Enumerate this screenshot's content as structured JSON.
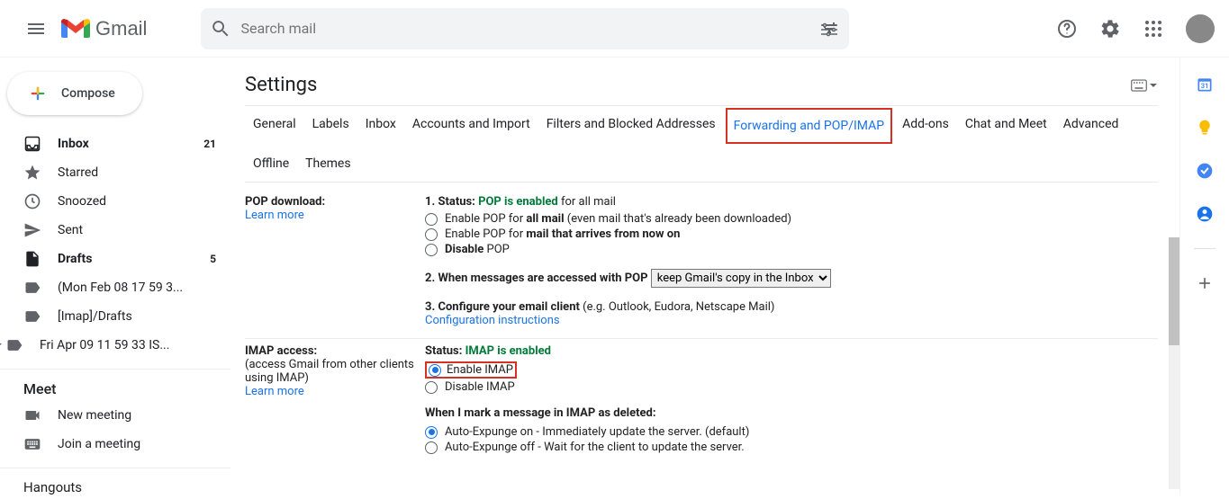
{
  "header": {
    "product": "Gmail",
    "search_placeholder": "Search mail"
  },
  "sidebar": {
    "compose": "Compose",
    "items": [
      {
        "label": "Inbox",
        "count": "21",
        "icon": "inbox",
        "bold": true
      },
      {
        "label": "Starred",
        "count": "",
        "icon": "star",
        "bold": false
      },
      {
        "label": "Snoozed",
        "count": "",
        "icon": "clock",
        "bold": false
      },
      {
        "label": "Sent",
        "count": "",
        "icon": "send",
        "bold": false
      },
      {
        "label": "Drafts",
        "count": "5",
        "icon": "file",
        "bold": true
      },
      {
        "label": "(Mon Feb 08 17 59 3...",
        "count": "",
        "icon": "label",
        "bold": false
      },
      {
        "label": "[Imap]/Drafts",
        "count": "",
        "icon": "label",
        "bold": false
      },
      {
        "label": "Fri Apr 09 11 59 33 IS...",
        "count": "",
        "icon": "label",
        "bold": false
      }
    ],
    "meet_header": "Meet",
    "new_meeting": "New meeting",
    "join_meeting": "Join a meeting",
    "hangouts_header": "Hangouts"
  },
  "settings": {
    "title": "Settings",
    "tabs": [
      {
        "label": "General",
        "active": false
      },
      {
        "label": "Labels",
        "active": false
      },
      {
        "label": "Inbox",
        "active": false
      },
      {
        "label": "Accounts and Import",
        "active": false
      },
      {
        "label": "Filters and Blocked Addresses",
        "active": false
      },
      {
        "label": "Forwarding and POP/IMAP",
        "active": true,
        "highlighted": true
      },
      {
        "label": "Add-ons",
        "active": false
      },
      {
        "label": "Chat and Meet",
        "active": false
      },
      {
        "label": "Advanced",
        "active": false
      },
      {
        "label": "Offline",
        "active": false
      },
      {
        "label": "Themes",
        "active": false
      }
    ],
    "pop": {
      "heading": "POP download:",
      "learn_more": "Learn more",
      "status_prefix": "1. Status: ",
      "status_value": "POP is enabled",
      "status_suffix": " for all mail",
      "radio1_pre": "Enable POP for ",
      "radio1_bold": "all mail",
      "radio1_post": " (even mail that's already been downloaded)",
      "radio2_pre": "Enable POP for ",
      "radio2_bold": "mail that arrives from now on",
      "radio3_bold": "Disable",
      "radio3_post": " POP",
      "line2": "2. When messages are accessed with POP",
      "select_value": "keep Gmail's copy in the Inbox",
      "line3_bold": "3. Configure your email client",
      "line3_rest": " (e.g. Outlook, Eudora, Netscape Mail)",
      "config_link": "Configuration instructions"
    },
    "imap": {
      "heading": "IMAP access:",
      "sub": "(access Gmail from other clients using IMAP)",
      "learn_more": "Learn more",
      "status_prefix": "Status: ",
      "status_value": "IMAP is enabled",
      "enable": "Enable IMAP",
      "disable": "Disable IMAP",
      "deleted_heading": "When I mark a message in IMAP as deleted:",
      "expunge_on": "Auto-Expunge on - Immediately update the server. (default)",
      "expunge_off": "Auto-Expunge off - Wait for the client to update the server."
    }
  }
}
